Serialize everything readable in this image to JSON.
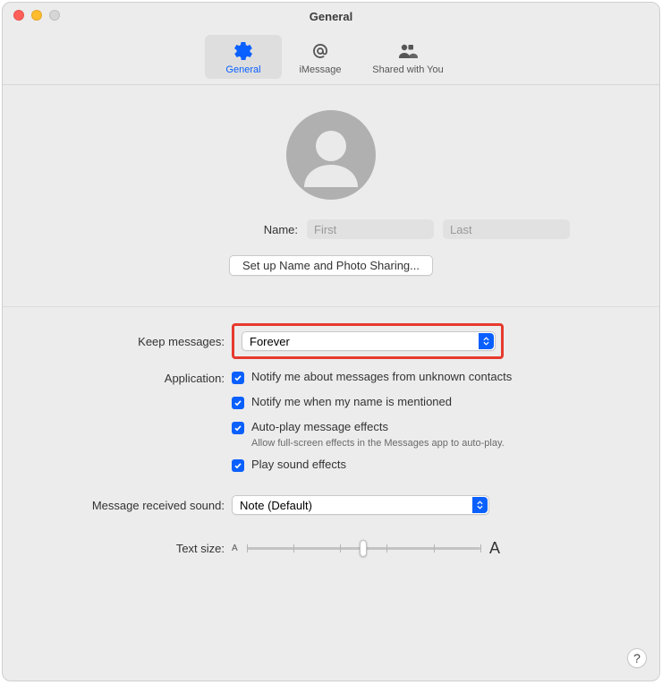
{
  "window": {
    "title": "General"
  },
  "tabs": {
    "general": "General",
    "imessage": "iMessage",
    "shared": "Shared with You"
  },
  "profile": {
    "name_label": "Name:",
    "first_placeholder": "First",
    "last_placeholder": "Last",
    "setup_button": "Set up Name and Photo Sharing..."
  },
  "keep": {
    "label": "Keep messages:",
    "value": "Forever"
  },
  "application": {
    "label": "Application:",
    "opts": [
      "Notify me about messages from unknown contacts",
      "Notify me when my name is mentioned",
      "Auto-play message effects",
      "Play sound effects"
    ],
    "autoplay_sub": "Allow full-screen effects in the Messages app to auto-play."
  },
  "sound": {
    "label": "Message received sound:",
    "value": "Note (Default)"
  },
  "textsize": {
    "label": "Text size:",
    "small": "A",
    "big": "A"
  },
  "help": "?"
}
